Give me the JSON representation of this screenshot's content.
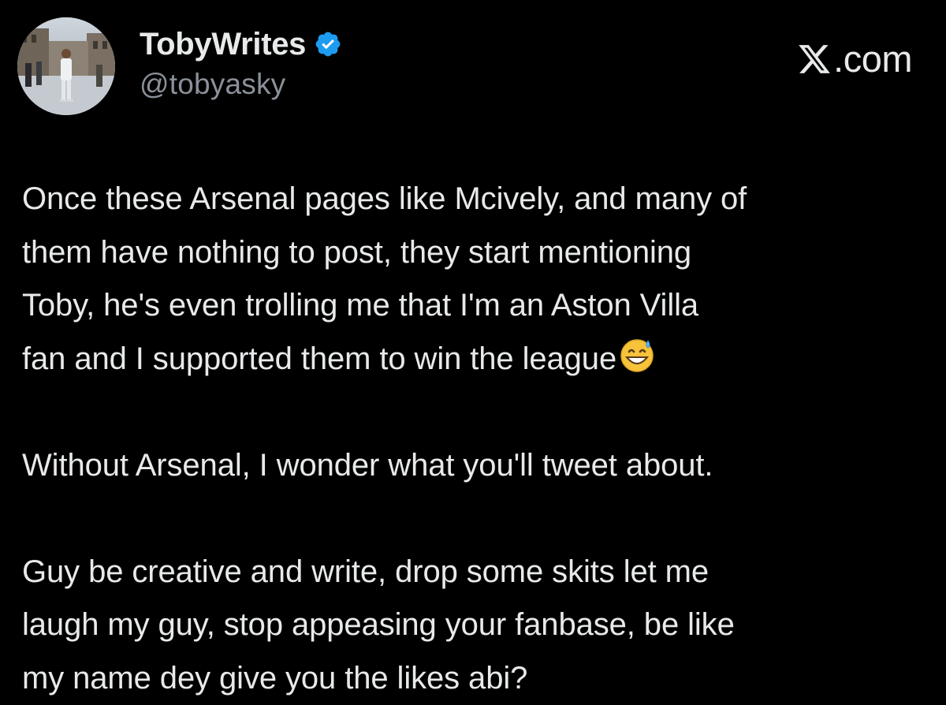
{
  "brand": {
    "logo_icon": "x-logo-icon",
    "text": ".com"
  },
  "author": {
    "display_name": "TobyWrites",
    "handle": "@tobyasky",
    "verified_icon": "verified-badge-icon",
    "verified_color": "#1d9bf0"
  },
  "tweet": {
    "paragraphs": [
      {
        "lines": [
          "Once these Arsenal pages like Mcively, and many of",
          "them have nothing to post, they start mentioning",
          "Toby, he's even trolling me that I'm an Aston Villa",
          "fan and I supported them to win the league"
        ],
        "trailing_emoji": "grinning-face-with-sweat-emoji"
      },
      {
        "lines": [
          "Without Arsenal, I wonder what you'll tweet about."
        ]
      },
      {
        "lines": [
          "Guy be creative and write, drop some skits let me",
          "laugh my guy, stop appeasing your fanbase, be like",
          "my name dey give you the likes abi?"
        ]
      }
    ]
  },
  "colors": {
    "background": "#000000",
    "text": "#e7e9ea",
    "secondary_text": "#8b9199"
  }
}
